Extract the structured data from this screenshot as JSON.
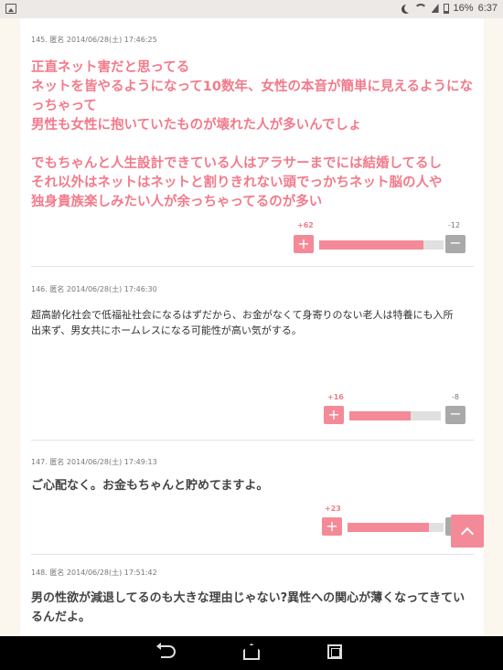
{
  "status": {
    "battery": "16%",
    "time": "6:37"
  },
  "comments": [
    {
      "meta": "145. 匿名 2014/06/28(土) 17:46:25",
      "lines": [
        "正直ネット害だと思ってる",
        "ネットを皆やるようになって10数年、女性の本音が簡単に見えるようにな",
        "っちゃって",
        "男性も女性に抱いていたものが壊れた人が多いんでしょ",
        "",
        "でもちゃんと人生設計できている人はアラサーまでには結婚してるし",
        "それ以外はネットはネットと割りきれない頭でっかちネット脳の人や",
        "独身貴族楽しみたい人が余っちゃってるのが多い"
      ],
      "plus": "+62",
      "minus": "-12",
      "ratio": 0.84
    },
    {
      "meta": "146. 匿名 2014/06/28(土) 17:46:30",
      "lines": [
        "超高齢化社会で低福祉社会になるはずだから、お金がなくて身寄りのない老人は特養にも入所",
        "出来ず、男女共にホームレスになる可能性が高い気がする。"
      ],
      "plus": "+16",
      "minus": "-8",
      "ratio": 0.67
    },
    {
      "meta": "147. 匿名 2014/06/28(土) 17:49:13",
      "lines": [
        "ご心配なく。お金もちゃんと貯めてますよ。"
      ],
      "plus": "+23",
      "minus": "",
      "ratio": 0.85
    },
    {
      "meta": "148. 匿名 2014/06/28(土) 17:51:42",
      "lines": [
        "男の性欲が減退してるのも大きな理由じゃない?異性への関心が薄くなってきてい",
        "るんだよ。"
      ]
    }
  ],
  "buttons": {
    "plus": "+",
    "minus": "−"
  },
  "colors": {
    "accent": "#f48a98",
    "text_pink": "#f27b8b",
    "minus_gray": "#a9a9a9"
  }
}
